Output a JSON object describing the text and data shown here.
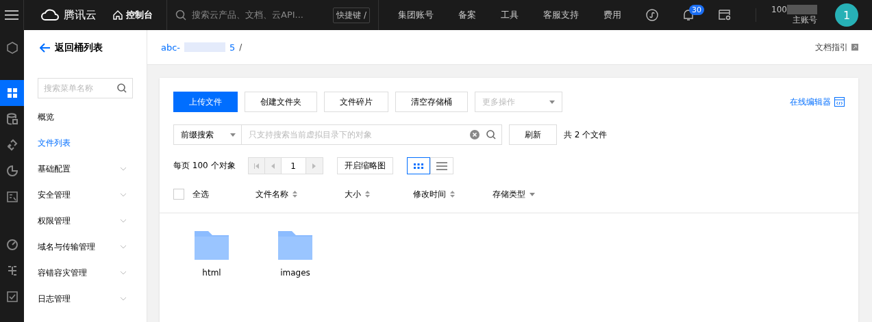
{
  "topbar": {
    "brand": "腾讯云",
    "console": "控制台",
    "search_placeholder": "搜索云产品、文档、云API...",
    "shortcut": "快捷键 /",
    "nav": [
      "集团账号",
      "备案",
      "工具",
      "客服支持",
      "费用"
    ],
    "notification_count": "30",
    "account_id": "100",
    "account_role": "主账号",
    "avatar": "1"
  },
  "rail": [
    {
      "selected": false
    },
    {
      "selected": true
    },
    {
      "selected": false
    },
    {
      "selected": false
    },
    {
      "selected": false
    },
    {
      "selected": false
    },
    {
      "selected": false
    },
    {
      "selected": false
    },
    {
      "selected": false
    }
  ],
  "sidebar": {
    "back": "返回桶列表",
    "search_placeholder": "搜索菜单名称",
    "items": [
      {
        "label": "概览",
        "selected": false,
        "expandable": false
      },
      {
        "label": "文件列表",
        "selected": true,
        "expandable": false
      },
      {
        "label": "基础配置",
        "selected": false,
        "expandable": true
      },
      {
        "label": "安全管理",
        "selected": false,
        "expandable": true
      },
      {
        "label": "权限管理",
        "selected": false,
        "expandable": true
      },
      {
        "label": "域名与传输管理",
        "selected": false,
        "expandable": true
      },
      {
        "label": "容错容灾管理",
        "selected": false,
        "expandable": true
      },
      {
        "label": "日志管理",
        "selected": false,
        "expandable": true
      }
    ]
  },
  "header": {
    "breadcrumb": "abc-",
    "breadcrumb_tail": "5",
    "separator": "/",
    "doc_link": "文档指引"
  },
  "actions": [
    {
      "label": "上传文件",
      "primary": true,
      "disabled": false
    },
    {
      "label": "创建文件夹",
      "primary": false,
      "disabled": false
    },
    {
      "label": "文件碎片",
      "primary": false,
      "disabled": false
    },
    {
      "label": "清空存储桶",
      "primary": false,
      "disabled": false
    }
  ],
  "more_actions": "更多操作",
  "online_editor": "在线编辑器",
  "search": {
    "mode": "前缀搜索",
    "placeholder": "只支持搜索当前虚拟目录下的对象",
    "refresh": "刷新",
    "total": "共 2 个文件"
  },
  "paging": {
    "per_page": "每页 100 个对象",
    "page": "1",
    "thumbnail": "开启缩略图",
    "views": [
      {
        "kind": "grid",
        "selected": true
      },
      {
        "kind": "list",
        "selected": false
      }
    ]
  },
  "columns": [
    {
      "label": "全选",
      "kind": "checkbox",
      "checked": false
    },
    {
      "label": "文件名称",
      "kind": "sort"
    },
    {
      "label": "大小",
      "kind": "sort"
    },
    {
      "label": "修改时间",
      "kind": "sort"
    },
    {
      "label": "存储类型",
      "kind": "filter"
    }
  ],
  "files": [
    {
      "name": "html"
    },
    {
      "name": "images"
    }
  ]
}
